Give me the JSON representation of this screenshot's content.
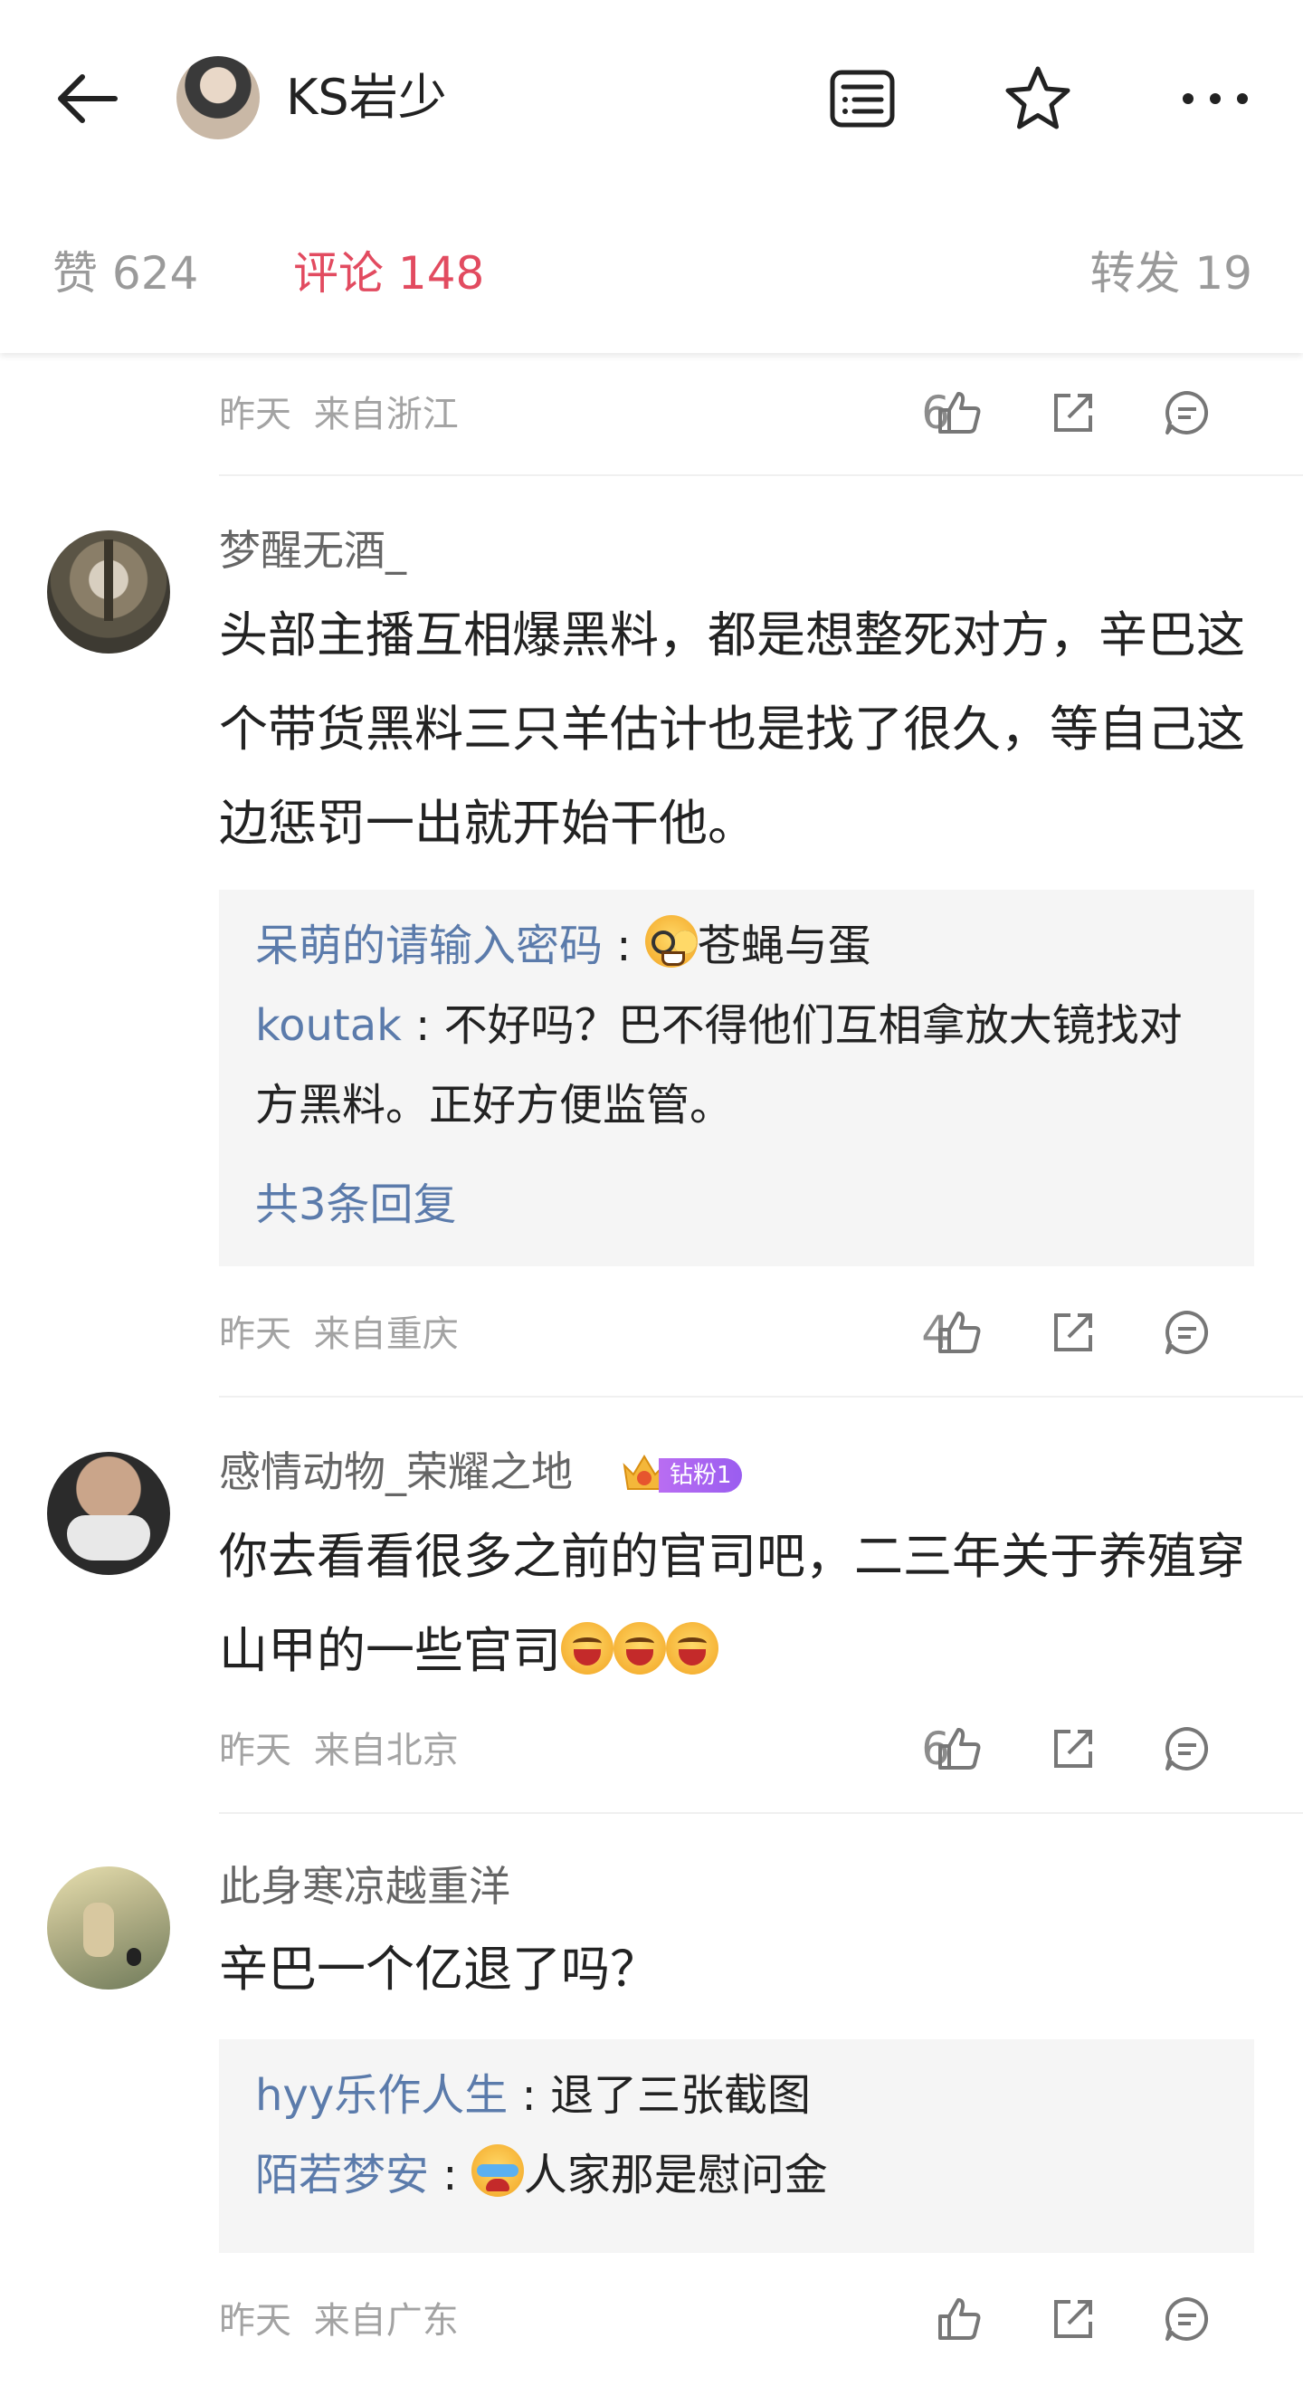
{
  "header": {
    "title": "KS岩少",
    "back_icon": "back-arrow-icon",
    "menu_icon": "article-list-icon",
    "star_icon": "star-icon",
    "more_icon": "more-dots-icon"
  },
  "stats": {
    "likes": "赞 624",
    "comments": "评论 148",
    "reposts": "转发 19",
    "accent_color": "#e24b60"
  },
  "comments": [
    {
      "time": "昨天",
      "location": "来自浙江",
      "like_count": "6"
    },
    {
      "username": "梦醒无酒_",
      "content": "头部主播互相爆黑料，都是想整死对方，辛巴这个带货黑料三只羊估计也是找了很久，等自己这边惩罚一出就开始干他。",
      "replies": [
        {
          "name": "呆萌的请输入密码",
          "sep": " : ",
          "text": "苍蝇与蛋",
          "emoji": "nerd-face-emoji"
        },
        {
          "name": "koutak",
          "sep": " : ",
          "text": "不好吗？巴不得他们互相拿放大镜找对方黑料。正好方便监管。"
        }
      ],
      "more_replies": "共3条回复",
      "time": "昨天",
      "location": "来自重庆",
      "like_count": "4"
    },
    {
      "username": "感情动物_荣耀之地",
      "badge": "钻粉1",
      "content": "你去看看很多之前的官司吧，二三年关于养殖穿山甲的一些官司",
      "emojis": [
        "laugh-emoji",
        "laugh-emoji",
        "laugh-emoji"
      ],
      "time": "昨天",
      "location": "来自北京",
      "like_count": "6"
    },
    {
      "username": "此身寒凉越重洋",
      "content": "辛巴一个亿退了吗？",
      "replies": [
        {
          "name": "hyy乐作人生",
          "sep": " : ",
          "text": "退了三张截图"
        },
        {
          "name": "陌若梦安",
          "sep": " : ",
          "text": "人家那是慰问金",
          "emoji": "cry-laugh-emoji"
        }
      ],
      "time": "昨天",
      "location": "来自广东",
      "like_count": ""
    }
  ]
}
